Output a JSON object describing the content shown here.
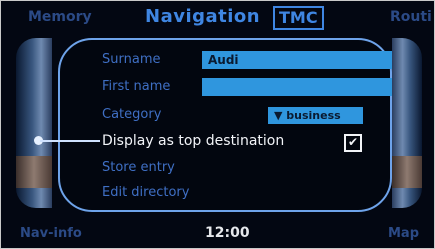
{
  "header": {
    "left_label": "Memory",
    "title": "Navigation",
    "badge": "TMC",
    "right_label": "Routi"
  },
  "form": {
    "surname_label": "Surname",
    "surname_value": "Audi",
    "firstname_label": "First name",
    "firstname_value": "",
    "category_label": "Category",
    "category_value": "▼ business",
    "top_destination_label": "Display as top destination",
    "top_destination_checked": true,
    "store_entry_label": "Store entry",
    "edit_directory_label": "Edit directory"
  },
  "footer": {
    "left_label": "Nav-info",
    "time": "12:00",
    "right_label": "Map"
  },
  "colors": {
    "accent_blue": "#3f86e2",
    "field_blue": "#2f96de",
    "background": "#030712"
  }
}
